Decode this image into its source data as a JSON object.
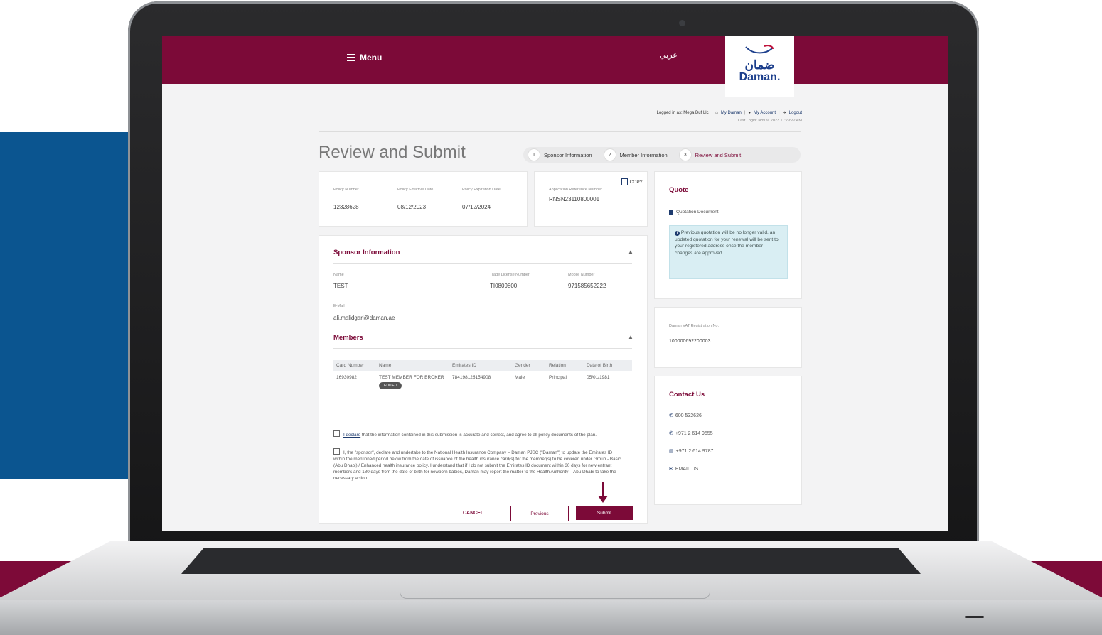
{
  "nav": {
    "menu_label": "Menu",
    "language_label": "عربي",
    "logo_arabic": "ضمان",
    "logo_english": "Daman."
  },
  "account_bar": {
    "logged_in_as": "Logged in as: Mega Duf Llc",
    "my_daman": "My Daman",
    "my_account": "My Account",
    "logout": "Logout",
    "last_login": "Last Login: Nov 9, 2023 11:29:22 AM"
  },
  "page": {
    "title": "Review and Submit"
  },
  "stepper": [
    {
      "num": "1",
      "label": "Sponsor Information"
    },
    {
      "num": "2",
      "label": "Member Information"
    },
    {
      "num": "3",
      "label": "Review and Submit",
      "active": true
    }
  ],
  "policy": {
    "number_label": "Policy Number",
    "number_value": "12328628",
    "effective_label": "Policy Effective Date",
    "effective_value": "08/12/2023",
    "expiration_label": "Policy Expiration Date",
    "expiration_value": "07/12/2024"
  },
  "application": {
    "copy_label": "COPY",
    "ref_label": "Application Reference Number",
    "ref_value": "RNSN23110800001"
  },
  "sponsor": {
    "section_title": "Sponsor Information",
    "name_label": "Name",
    "name_value": "TEST",
    "trade_license_label": "Trade License Number",
    "trade_license_value": "TI0809800",
    "mobile_label": "Mobile Number",
    "mobile_value": "971585652222",
    "email_label": "E-Mail",
    "email_value": "ali.malidgari@daman.ae"
  },
  "members": {
    "section_title": "Members",
    "headers": {
      "card": "Card Number",
      "name": "Name",
      "emirates": "Emirates ID",
      "gender": "Gender",
      "relation": "Relation",
      "dob": "Date of Birth"
    },
    "rows": [
      {
        "card": "16930982",
        "name": "TEST MEMBER FOR BROKER",
        "emirates": "784198125154908",
        "gender": "Male",
        "relation": "Principal",
        "dob": "05/01/1981",
        "badge": "EDITED"
      }
    ]
  },
  "declarations": {
    "first_link": "I declare",
    "first_text": " that the information contained in this submission is accurate and correct, and agree to all policy documents of the plan.",
    "second_text": "I, the \"sponsor\", declare and undertake to the National Health Insurance Company – Daman PJSC (\"Daman\") to update the Emirates ID within the mentioned period below from the date of issuance of the health insurance card(s) for the member(s) to be covered under Group - Basic (Abu Dhabi) / Enhanced health insurance policy. I understand that if I do not submit the Emirates ID document within 30 days for new entrant members and 180 days from the date of birth for newborn babies, Daman may report the matter to the Health Authority – Abu Dhabi to take the necessary action."
  },
  "actions": {
    "cancel": "CANCEL",
    "previous": "Previous",
    "submit": "Submit"
  },
  "quote": {
    "title": "Quote",
    "document_label": "Quotation Document",
    "info_text": "Previous quotation will be no longer valid, an updated quotation for your renewal will be sent to your registered address once the member changes are approved."
  },
  "vat": {
    "label": "Daman VAT Registration No.",
    "value": "100000692200003"
  },
  "contact": {
    "title": "Contact Us",
    "phone1": "600 532626",
    "phone2": "+971 2 614 9555",
    "fax": "+971 2 614 9787",
    "email": "EMAIL US"
  },
  "colors": {
    "brand": "#7c0a38",
    "backdrop_blue": "#0b5590",
    "info_box": "#d9eef3"
  }
}
